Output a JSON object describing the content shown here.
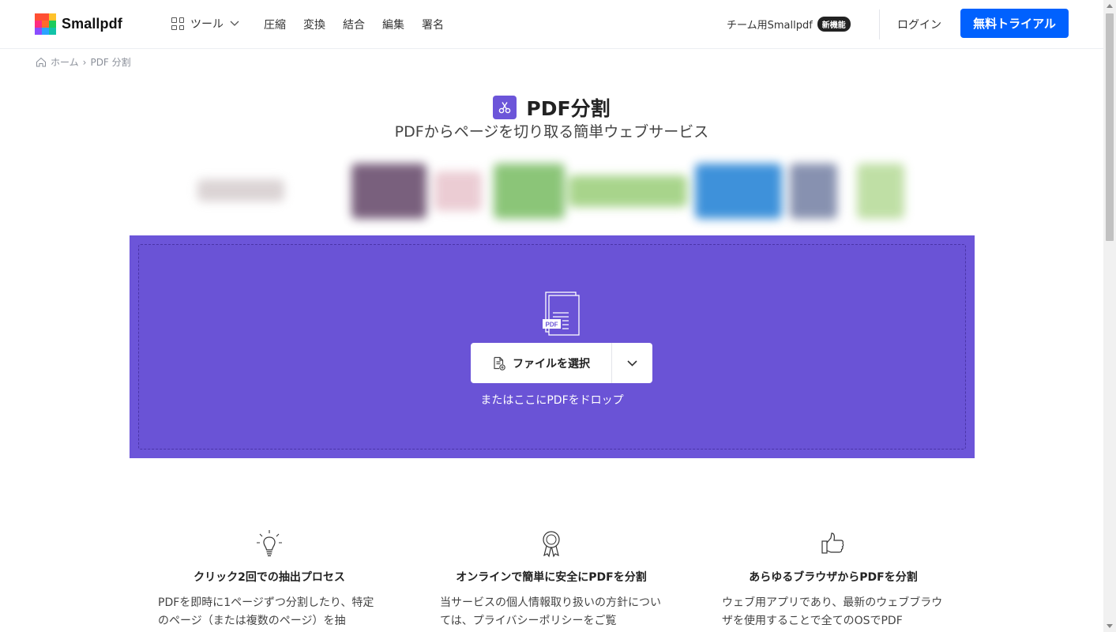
{
  "header": {
    "logo_text": "Smallpdf",
    "tools_label": "ツール",
    "nav": [
      "圧縮",
      "変換",
      "結合",
      "編集",
      "署名"
    ],
    "team_label": "チーム用Smallpdf",
    "team_badge": "新機能",
    "login_label": "ログイン",
    "trial_label": "無料トライアル"
  },
  "breadcrumb": {
    "home": "ホーム",
    "separator": "›",
    "current": "PDF 分割"
  },
  "hero": {
    "title": "PDF分割",
    "subtitle": "PDFからページを切り取る簡単ウェブサービス"
  },
  "dropzone": {
    "file_badge": "PDF",
    "choose_label": "ファイルを選択",
    "drop_hint": "またはここにPDFをドロップ"
  },
  "features": [
    {
      "icon": "lightbulb-icon",
      "title": "クリック2回での抽出プロセス",
      "text": "PDFを即時に1ページずつ分割したり、特定のページ（または複数のページ）を抽"
    },
    {
      "icon": "award-ribbon-icon",
      "title": "オンラインで簡単に安全にPDFを分割",
      "text": "当サービスの個人情報取り扱いの方針については、プライバシーポリシーをご覧"
    },
    {
      "icon": "thumbs-up-icon",
      "title": "あらゆるブラウザからPDFを分割",
      "text": "ウェブ用アプリであり、最新のウェブブラウザを使用することで全てのOSでPDF"
    }
  ],
  "colors": {
    "brand_purple": "#6c55d9",
    "primary_blue": "#0061fe",
    "logo_tiles": [
      "#ff4f33",
      "#ffc22b",
      "#1ccb5c",
      "#ff2b7f",
      "#8a4dff",
      "#2ba3ff",
      "#ffb020",
      "#2c6fff",
      "#12c3a8"
    ]
  }
}
